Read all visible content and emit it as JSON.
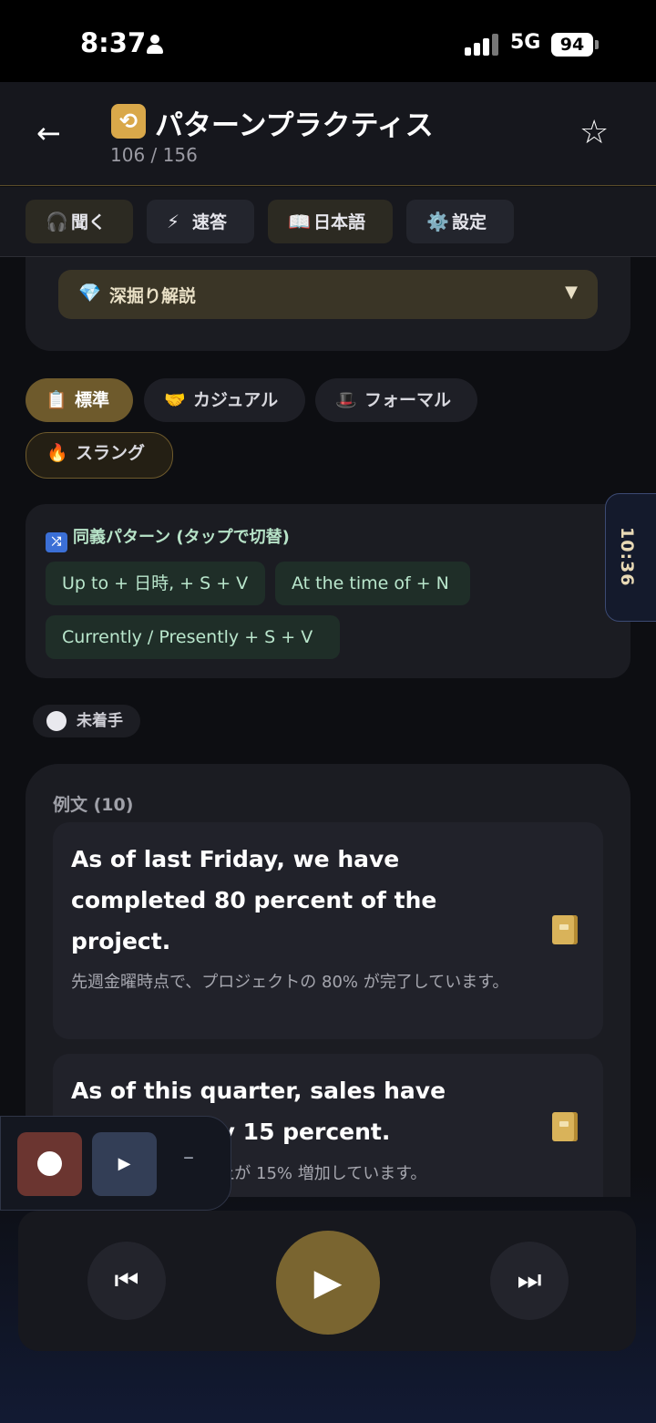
{
  "status_bar": {
    "time": "8:37",
    "network": "5G",
    "battery": "94"
  },
  "header": {
    "title": "パターンプラクティス",
    "progress": "106 / 156",
    "app_icon": "repeat-icon"
  },
  "toolbar": {
    "listen": {
      "icon": "🎧",
      "label": "聞く"
    },
    "quick": {
      "icon": "⚡",
      "label": "速答"
    },
    "japanese": {
      "icon": "📖",
      "label": "日本語"
    },
    "settings": {
      "icon": "⚙️",
      "label": "設定"
    }
  },
  "deep_dive": {
    "icon": "💎",
    "label": "深掘り解説",
    "caret": "▼"
  },
  "tones": [
    {
      "icon": "📋",
      "label": "標準",
      "active": true
    },
    {
      "icon": "🤝",
      "label": "カジュアル",
      "active": false
    },
    {
      "icon": "🎩",
      "label": "フォーマル",
      "active": false
    },
    {
      "icon": "🔥",
      "label": "スラング",
      "active": false
    }
  ],
  "synonyms": {
    "title": "同義パターン (タップで切替)",
    "items": [
      "Up to + 日時, + S + V",
      "At the time of + N",
      "Currently / Presently + S + V"
    ]
  },
  "timer": "10:36",
  "learning_status": "未着手",
  "examples": {
    "header": "例文 (10)",
    "items": [
      {
        "en": "As of last Friday, we have completed 80 percent of the project.",
        "ja": "先週金曜時点で、プロジェクトの 80% が完了しています。"
      },
      {
        "en": "As of this quarter, sales have increased by 15 percent.",
        "ja": "今四半期時点で、売上が 15% 増加しています。"
      }
    ]
  },
  "recorder": {
    "play": "▶",
    "minimize": "–"
  },
  "player": {
    "prev": "⏮",
    "play": "▶",
    "next": "⏭"
  },
  "colors": {
    "accent": "#7a6530",
    "synonym_text": "#b9e6cc",
    "timer_text": "#e8d9b5"
  }
}
